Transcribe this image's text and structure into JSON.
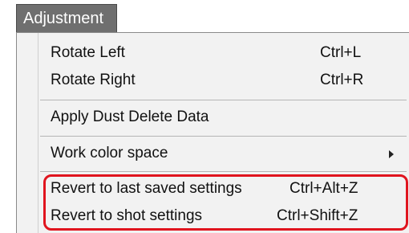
{
  "menubar": {
    "title": "Adjustment"
  },
  "menu": {
    "items": [
      {
        "label": "Rotate Left",
        "shortcut": "Ctrl+L"
      },
      {
        "label": "Rotate Right",
        "shortcut": "Ctrl+R"
      },
      {
        "label": "Apply Dust Delete Data",
        "shortcut": ""
      },
      {
        "label": "Work color space",
        "shortcut": ""
      },
      {
        "label": "Revert to last saved settings",
        "shortcut": "Ctrl+Alt+Z"
      },
      {
        "label": "Revert to shot settings",
        "shortcut": "Ctrl+Shift+Z"
      }
    ]
  },
  "colors": {
    "highlight": "#e0141e",
    "menubar_tab": "#6f6f6f",
    "menu_bg": "#f2f2f2"
  }
}
